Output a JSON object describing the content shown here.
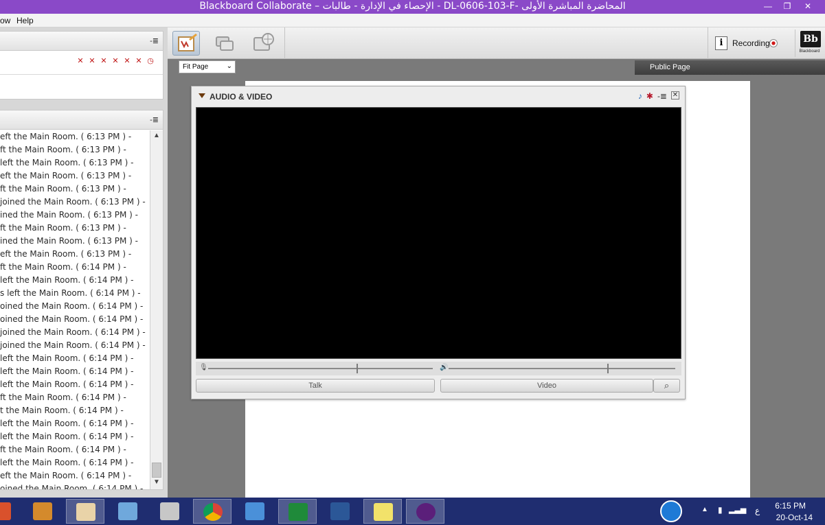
{
  "window": {
    "title": "Blackboard Collaborate – الإحصاء في الإدارة - طالبات - DL-0606-103-F- المحاضرة المباشرة الأولى",
    "minimize": "—",
    "restore": "❐",
    "close": "✕"
  },
  "menu": {
    "items": [
      "ow",
      "Help"
    ]
  },
  "left": {
    "panel_menu_glyph": "-≣",
    "chat_lines": [
      "eft the Main Room. ( 6:13 PM ) -",
      "ft the Main Room. ( 6:13 PM ) -",
      " left the Main Room. ( 6:13 PM ) -",
      "eft the Main Room. ( 6:13 PM ) -",
      "ft the Main Room. ( 6:13 PM ) -",
      " joined the Main Room. ( 6:13 PM ) -",
      "ined the Main Room. ( 6:13 PM ) -",
      "ft the Main Room. ( 6:13 PM ) -",
      "ined the Main Room. ( 6:13 PM ) -",
      "eft the Main Room. ( 6:13 PM ) -",
      "ft the Main Room. ( 6:14 PM ) -",
      "  left the Main Room. ( 6:14 PM ) -",
      "s  left the Main Room. ( 6:14 PM ) -",
      "oined the Main Room. ( 6:14 PM ) -",
      "oined the Main Room. ( 6:14 PM ) -",
      " joined the Main Room. ( 6:14 PM ) -",
      " joined the Main Room. ( 6:14 PM ) -",
      " left the Main Room. ( 6:14 PM ) -",
      " left the Main Room. ( 6:14 PM ) -",
      " left the Main Room. ( 6:14 PM ) -",
      "ft the Main Room. ( 6:14 PM ) -",
      "t the Main Room. ( 6:14 PM ) -",
      " left the Main Room. ( 6:14 PM ) -",
      "left the Main Room. ( 6:14 PM ) -",
      "ft the Main Room. ( 6:14 PM ) -",
      " left the Main Room. ( 6:14 PM ) -",
      "eft the Main Room. ( 6:14 PM ) -",
      "oined the Main Room. ( 6:14 PM ) -"
    ]
  },
  "toolbar": {
    "recording_label": "Recording",
    "info_glyph": "i",
    "logo_mark": "Bb",
    "logo_text": "Blackboard"
  },
  "content": {
    "zoom_value": "Fit Page",
    "tab_label": "Public Page"
  },
  "audio_video": {
    "title": "AUDIO & VIDEO",
    "talk_label": "Talk",
    "video_label": "Video",
    "mic_level": 0.66,
    "speaker_level": 0.7
  },
  "taskbar": {
    "time": "6:15 PM",
    "date": "20-Oct-14",
    "lang": "ع"
  },
  "colors": {
    "titlebar": "#8a49c8",
    "taskbar": "#1f2d70",
    "video_bg": "#000000"
  }
}
